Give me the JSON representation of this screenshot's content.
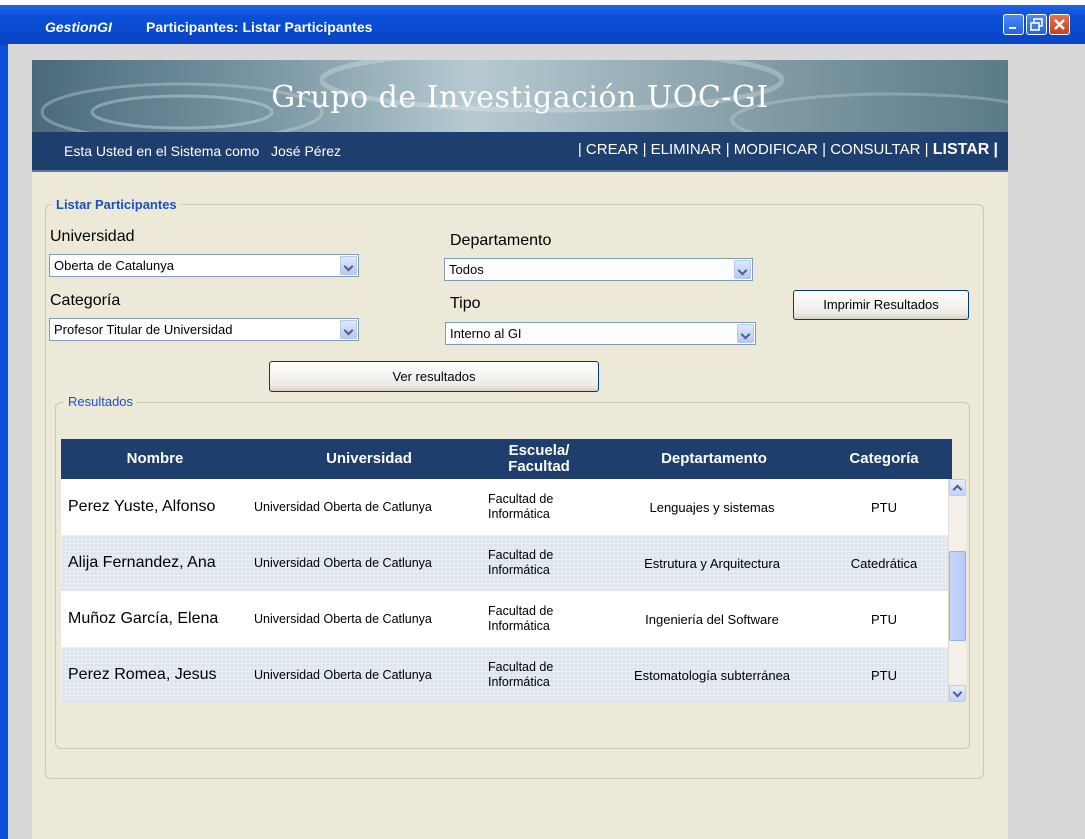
{
  "window": {
    "app_name": "GestionGI",
    "title": "Participantes: Listar Participantes",
    "min_icon": "minimize-icon",
    "max_icon": "restore-icon",
    "close_icon": "close-icon"
  },
  "banner": {
    "title": "Grupo de Investigación UOC-GI"
  },
  "navbar": {
    "user_text": "Esta Usted en el Sistema como   José Pérez",
    "sep": "|",
    "items": [
      "CREAR",
      "ELIMINAR",
      "MODIFICAR",
      "CONSULTAR",
      "LISTAR"
    ],
    "active": "LISTAR"
  },
  "filters": {
    "legend": "Listar Participantes",
    "universidad": {
      "label": "Universidad",
      "value": "Oberta de Catalunya"
    },
    "departamento": {
      "label": "Departamento",
      "value": "Todos"
    },
    "categoria": {
      "label": "Categoría",
      "value": "Profesor Titular de Universidad"
    },
    "tipo": {
      "label": "Tipo",
      "value": "Interno al GI"
    },
    "print_button": "Imprimir Resultados",
    "view_button": "Ver resultados"
  },
  "results": {
    "legend": "Resultados",
    "columns": [
      "Nombre",
      "Universidad",
      "Escuela/ Facultad",
      "Deptartamento",
      "Categoría"
    ],
    "rows": [
      {
        "nombre": "Perez Yuste, Alfonso",
        "universidad": "Universidad Oberta de Catlunya",
        "facultad_1": "Facultad de",
        "facultad_2": "Informática",
        "departamento": "Lenguajes y sistemas",
        "categoria": "PTU"
      },
      {
        "nombre": "Alija Fernandez, Ana",
        "universidad": "Universidad Oberta de Catlunya",
        "facultad_1": "Facultad de",
        "facultad_2": "Informática",
        "departamento": "Estrutura y Arquitectura",
        "categoria": "Catedrática"
      },
      {
        "nombre": "Muñoz García, Elena",
        "universidad": "Universidad Oberta de Catlunya",
        "facultad_1": "Facultad de",
        "facultad_2": "Informática",
        "departamento": "Ingeniería del Software",
        "categoria": "PTU"
      },
      {
        "nombre": "Perez Romea, Jesus",
        "universidad": "Universidad Oberta de Catlunya",
        "facultad_1": "Facultad de",
        "facultad_2": "Informática",
        "departamento": "Estomatología subterránea",
        "categoria": "PTU"
      }
    ]
  }
}
